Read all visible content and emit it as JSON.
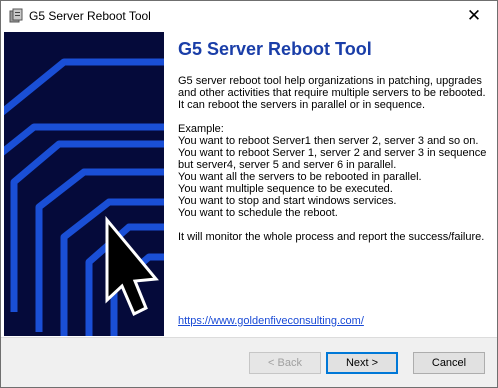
{
  "window": {
    "title": "G5 Server Reboot Tool",
    "close_glyph": "✕"
  },
  "icons": {
    "app": "server-icon",
    "close": "close-icon",
    "banner_pointer": "mouse-pointer-icon"
  },
  "colors": {
    "heading": "#1a3ea8",
    "banner_bg": "#050a3a",
    "banner_lines": "#1a4fd6",
    "link": "#1a4bd6",
    "default_button_border": "#0078d7"
  },
  "content": {
    "heading": "G5 Server Reboot Tool",
    "intro": [
      "G5 server reboot tool help organizations in patching, upgrades",
      "and other activities that require multiple servers to be rebooted.",
      "It can reboot the servers in parallel or in sequence."
    ],
    "example_lines": [
      "Example:",
      "You want to reboot Server1 then server 2, server 3 and so on.",
      "You want to reboot Server 1, server 2 and server 3 in sequence",
      "but server4, server 5 and server 6 in parallel.",
      "You want all the servers to be rebooted in parallel.",
      "You want multiple sequence to be executed.",
      "You want to stop and start windows services.",
      "You want to schedule the reboot."
    ],
    "summary": "It will monitor the whole process and report the success/failure.",
    "link": "https://www.goldenfiveconsulting.com/"
  },
  "buttons": {
    "back": "< Back",
    "next": "Next >",
    "cancel": "Cancel"
  }
}
